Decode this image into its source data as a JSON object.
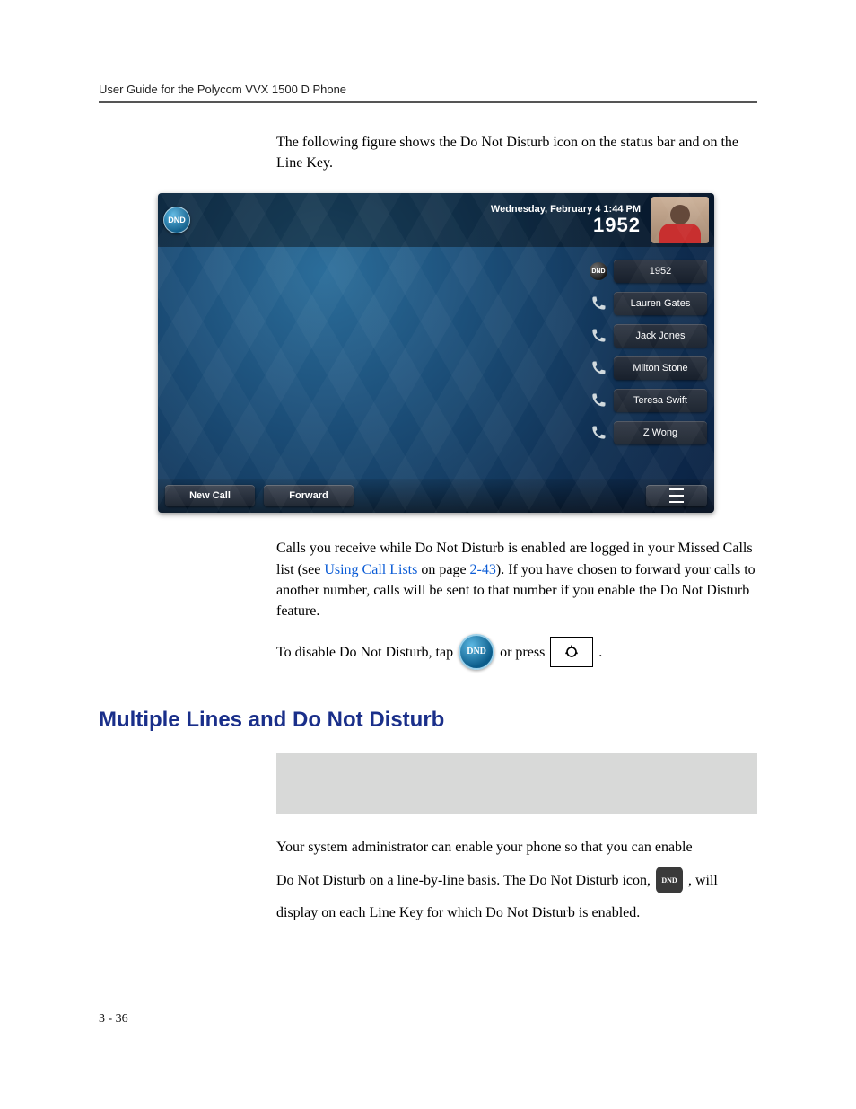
{
  "header": {
    "running_title": "User Guide for the Polycom VVX 1500 D Phone"
  },
  "intro_para": "The following figure shows the Do Not Disturb icon on the status bar and on the Line Key.",
  "phone": {
    "dnd_label": "DND",
    "datetime": "Wednesday, February 4  1:44 PM",
    "extension": "1952",
    "line_keys": [
      {
        "label": "1952",
        "icon": "dnd"
      },
      {
        "label": "Lauren Gates",
        "icon": "handset"
      },
      {
        "label": "Jack Jones",
        "icon": "handset"
      },
      {
        "label": "Milton Stone",
        "icon": "handset"
      },
      {
        "label": "Teresa Swift",
        "icon": "handset"
      },
      {
        "label": "Z Wong",
        "icon": "handset"
      }
    ],
    "softkeys": {
      "new_call": "New Call",
      "forward": "Forward"
    }
  },
  "after_fig": {
    "pre_link": "Calls you receive while Do Not Disturb is enabled are logged in your Missed Calls list (see ",
    "link_text": "Using Call Lists",
    "mid": " on page ",
    "page_ref": "2-43",
    "post": "). If you have chosen to forward your calls to another number, calls will be sent to that number if you enable the Do Not Disturb feature."
  },
  "disable_line": {
    "pre": "To disable Do Not Disturb, tap",
    "mid": "or press",
    "post": "."
  },
  "section_heading": "Multiple Lines and Do Not Disturb",
  "admin_para": {
    "l1": "Your system administrator can enable your phone so that you can enable",
    "l2a": "Do Not Disturb on a line-by-line basis. The Do Not Disturb icon,",
    "l2b": ", will",
    "l3": "display on each Line Key for which Do Not Disturb is enabled."
  },
  "page_number": "3 - 36",
  "icon_text": {
    "dnd": "DND"
  }
}
